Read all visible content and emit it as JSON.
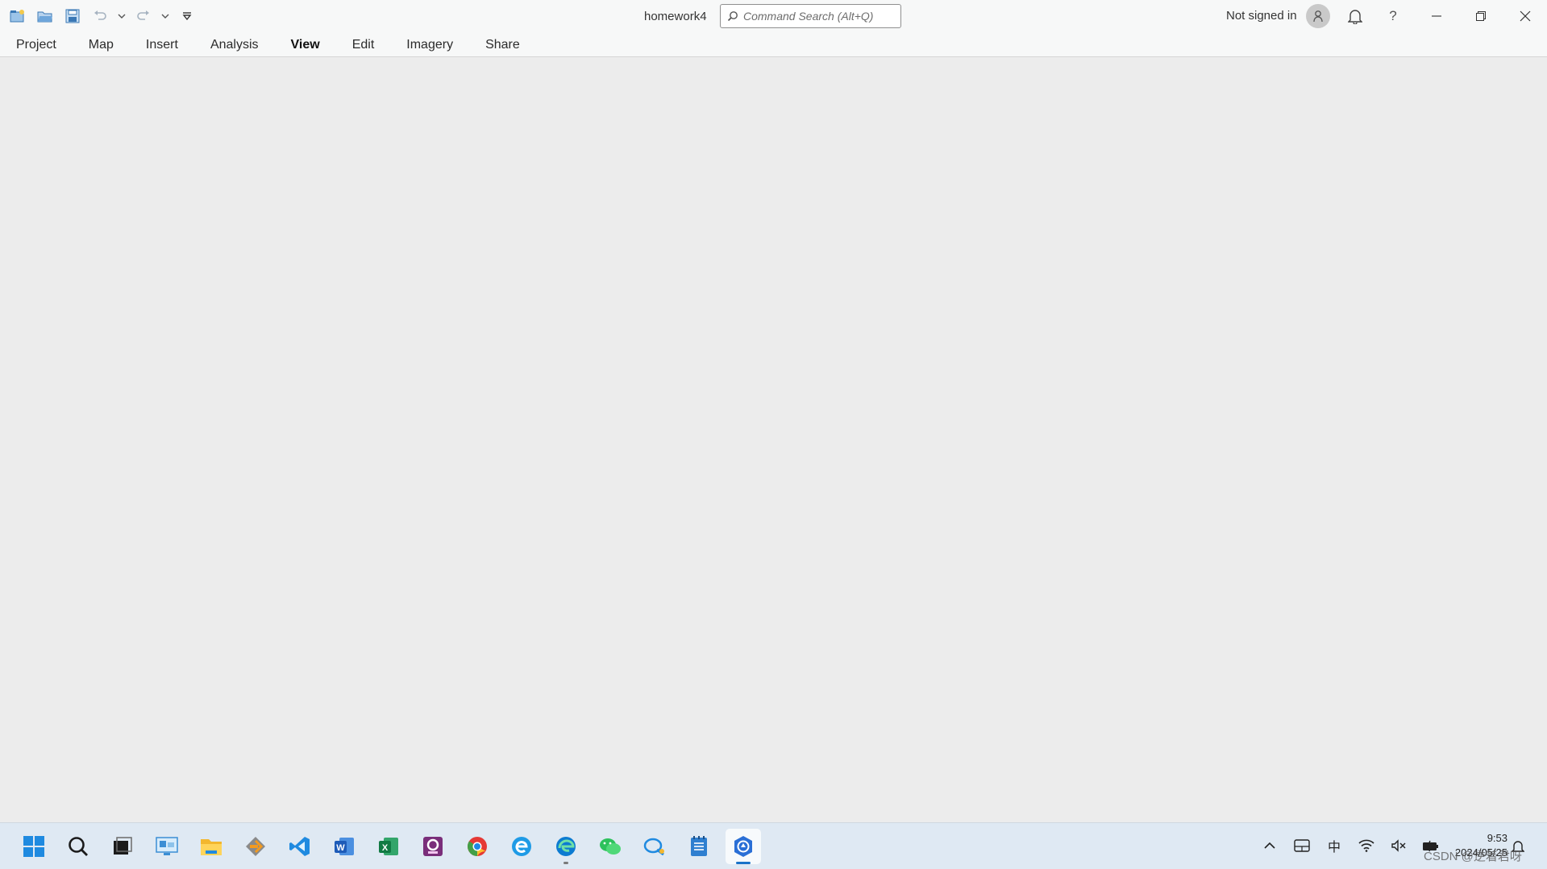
{
  "app": {
    "doc_title": "homework4",
    "search_placeholder": "Command Search (Alt+Q)",
    "account_status": "Not signed in",
    "help_label": "?"
  },
  "ribbon": {
    "tabs": [
      {
        "label": "Project",
        "active": false
      },
      {
        "label": "Map",
        "active": false
      },
      {
        "label": "Insert",
        "active": false
      },
      {
        "label": "Analysis",
        "active": false
      },
      {
        "label": "View",
        "active": true
      },
      {
        "label": "Edit",
        "active": false
      },
      {
        "label": "Imagery",
        "active": false
      },
      {
        "label": "Share",
        "active": false
      }
    ]
  },
  "quick_access": [
    "new-project-icon",
    "open-project-icon",
    "save-project-icon",
    "undo-icon",
    "undo-dropdown-icon",
    "redo-icon",
    "redo-dropdown-icon",
    "customize-qat-icon"
  ],
  "taskbar": {
    "apps": [
      {
        "name": "start-icon",
        "running": false,
        "active": false
      },
      {
        "name": "search-icon",
        "running": false,
        "active": false
      },
      {
        "name": "task-view-icon",
        "running": false,
        "active": false
      },
      {
        "name": "remote-desktop-icon",
        "running": false,
        "active": false
      },
      {
        "name": "file-explorer-icon",
        "running": false,
        "active": false
      },
      {
        "name": "app-arrow-icon",
        "running": false,
        "active": false
      },
      {
        "name": "vscode-icon",
        "running": false,
        "active": false
      },
      {
        "name": "word-icon",
        "running": false,
        "active": false
      },
      {
        "name": "excel-icon",
        "running": false,
        "active": false
      },
      {
        "name": "pdf-app-icon",
        "running": false,
        "active": false
      },
      {
        "name": "chrome-icon",
        "running": false,
        "active": false
      },
      {
        "name": "browser-e-icon",
        "running": false,
        "active": false
      },
      {
        "name": "edge-icon",
        "running": true,
        "active": false
      },
      {
        "name": "wechat-icon",
        "running": false,
        "active": false
      },
      {
        "name": "chat-app-icon",
        "running": false,
        "active": false
      },
      {
        "name": "notepad-icon",
        "running": false,
        "active": false
      },
      {
        "name": "arcgis-pro-icon",
        "running": true,
        "active": true
      }
    ],
    "tray": {
      "ime_label": "中",
      "time": "9:53",
      "date": "2024/05/25"
    },
    "watermark": "CSDN @逆着君呀"
  },
  "colors": {
    "workspace": "#ececec",
    "titlebar": "#f7f8f8",
    "taskbar": "#dfe9f3",
    "accent": "#1a73c8"
  }
}
